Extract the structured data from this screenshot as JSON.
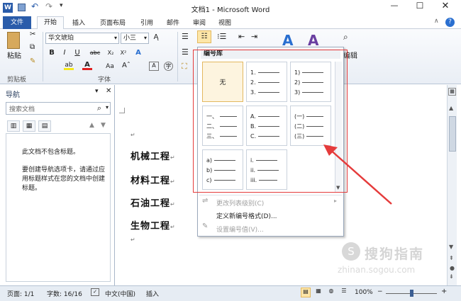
{
  "window": {
    "title": "文档1 - Microsoft Word"
  },
  "quick_access": [
    "save-icon",
    "undo-icon",
    "redo-icon"
  ],
  "tabs": [
    {
      "label": "文件",
      "kind": "file"
    },
    {
      "label": "开始",
      "kind": "active"
    },
    {
      "label": "插入"
    },
    {
      "label": "页面布局"
    },
    {
      "label": "引用"
    },
    {
      "label": "邮件"
    },
    {
      "label": "审阅"
    },
    {
      "label": "视图"
    }
  ],
  "ribbon": {
    "paste_label": "粘贴",
    "clipboard_group": "剪贴板",
    "font_group": "字体",
    "edit_label": "编辑",
    "font_name": "华文琥珀",
    "font_size": "小三",
    "font_buttons": [
      "B",
      "I",
      "U",
      "abc",
      "X₂",
      "X²",
      "Aa",
      "A"
    ]
  },
  "nav": {
    "title": "导航",
    "search_placeholder": "搜索文档",
    "message1": "此文档不包含标题。",
    "message2": "要创建导航选项卡，请通过应用标题样式在您的文档中创建标题。"
  },
  "document": {
    "headings": [
      "机械工程",
      "材料工程",
      "石油工程",
      "生物工程"
    ]
  },
  "numbering_library": {
    "title": "编号库",
    "none_label": "无",
    "cells": [
      [
        "1.",
        "2.",
        "3."
      ],
      [
        "1)",
        "2)",
        "3)"
      ],
      [
        "一、",
        "二、",
        "三、"
      ],
      [
        "A.",
        "B.",
        "C."
      ],
      [
        "(一)",
        "(二)",
        "(三)"
      ],
      [
        "a)",
        "b)",
        "c)"
      ],
      [
        "i.",
        "ii.",
        "iii."
      ]
    ],
    "menu": {
      "change_level": "更改列表级别(C)",
      "define_new": "定义新编号格式(D)...",
      "set_value": "设置编号值(V)..."
    }
  },
  "status": {
    "page": "页面: 1/1",
    "words": "字数: 16/16",
    "language": "中文(中国)",
    "mode": "插入",
    "zoom": "100%"
  },
  "watermark": {
    "text": "搜狗指南",
    "url": "zhinan.sogou.com"
  }
}
